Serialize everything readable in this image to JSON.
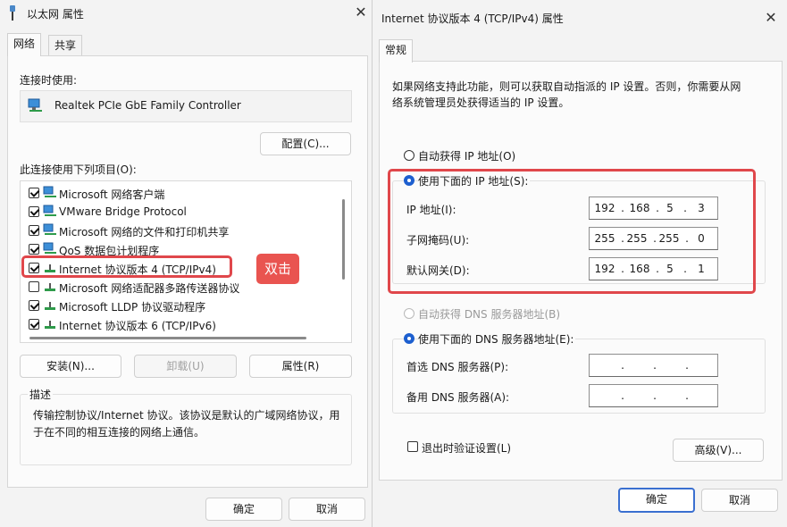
{
  "left_window": {
    "title": "以太网 属性",
    "tabs": [
      "网络",
      "共享"
    ],
    "connect_using_label": "连接时使用:",
    "adapter_name": "Realtek PCIe GbE Family Controller",
    "configure_button": "配置(C)...",
    "items_label": "此连接使用下列项目(O):",
    "items": [
      {
        "label": "Microsoft 网络客户端",
        "checked": true
      },
      {
        "label": "VMware Bridge Protocol",
        "checked": true
      },
      {
        "label": "Microsoft 网络的文件和打印机共享",
        "checked": true
      },
      {
        "label": "QoS 数据包计划程序",
        "checked": true
      },
      {
        "label": "Internet 协议版本 4 (TCP/IPv4)",
        "checked": true
      },
      {
        "label": "Microsoft 网络适配器多路传送器协议",
        "checked": false
      },
      {
        "label": "Microsoft LLDP 协议驱动程序",
        "checked": true
      },
      {
        "label": "Internet 协议版本 6 (TCP/IPv6)",
        "checked": true
      }
    ],
    "annotation_badge": "双击",
    "install_button": "安装(N)...",
    "uninstall_button": "卸载(U)",
    "properties_button": "属性(R)",
    "description_label": "描述",
    "description_text": "传输控制协议/Internet 协议。该协议是默认的广域网络协议，用于在不同的相互连接的网络上通信。",
    "ok_button": "确定",
    "cancel_button": "取消"
  },
  "right_window": {
    "title": "Internet 协议版本 4 (TCP/IPv4) 属性",
    "tab": "常规",
    "intro_line1": "如果网络支持此功能，则可以获取自动指派的 IP 设置。否则，你需要从网",
    "intro_line2": "络系统管理员处获得适当的 IP 设置。",
    "auto_ip_label": "自动获得 IP 地址(O)",
    "manual_ip_label": "使用下面的 IP 地址(S):",
    "ip_address_label": "IP 地址(I):",
    "ip_address": [
      "192",
      "168",
      "5",
      "3"
    ],
    "subnet_label": "子网掩码(U):",
    "subnet_mask": [
      "255",
      "255",
      "255",
      "0"
    ],
    "gateway_label": "默认网关(D):",
    "default_gateway": [
      "192",
      "168",
      "5",
      "1"
    ],
    "auto_dns_label": "自动获得 DNS 服务器地址(B)",
    "manual_dns_label": "使用下面的 DNS 服务器地址(E):",
    "preferred_dns_label": "首选 DNS 服务器(P):",
    "alternate_dns_label": "备用 DNS 服务器(A):",
    "validate_label": "退出时验证设置(L)",
    "advanced_button": "高级(V)...",
    "ok_button": "确定",
    "cancel_button": "取消"
  },
  "colors": {
    "highlight_red": "#e0474b",
    "badge_red": "#e95450",
    "accent_blue": "#1d5fcf"
  }
}
